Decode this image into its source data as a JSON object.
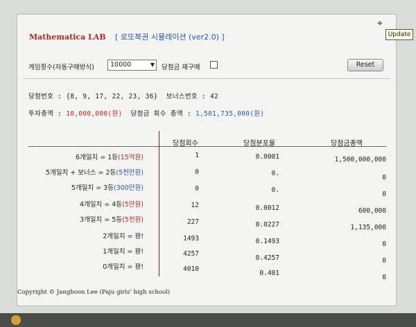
{
  "header": {
    "app_name": "Mathematica LAB",
    "sim_title": "[ 로또복권 시뮬레이션 (ver2.0) ]"
  },
  "controls": {
    "purchase_label": "게임횟수(자동구매방식)",
    "purchase_value": "10000",
    "repurchase_label": "당첨금 재구매",
    "repurchase_checked": false,
    "reset_label": "Reset"
  },
  "info": {
    "winning_label": "당첨번호 :",
    "winning_numbers": "{8, 9, 17, 22, 23, 36}",
    "bonus_label": "보너스번호 :",
    "bonus_number": "42",
    "investment_label": "투자총액 :",
    "investment_value": "10,000,000(원)",
    "prize_total_label": "당첨금 회수 총액 :",
    "prize_total_value": "1,501,735,000(원)"
  },
  "table": {
    "headers": [
      "당첨회수",
      "당첨분포율",
      "당첨금총액"
    ],
    "rows": [
      {
        "label": "6개일치 = 1등",
        "prize": "(15억원)",
        "count": "1",
        "rate": "0.0001",
        "amount": "1,500,000,000"
      },
      {
        "label": "5개일치 + 보너스 = 2등",
        "prize": "(5천만원)",
        "count": "0",
        "rate": "0.",
        "amount": "0"
      },
      {
        "label": "5개일치 = 3등",
        "prize": "(300만원)",
        "count": "0",
        "rate": "0.",
        "amount": "0"
      },
      {
        "label": "4개일치 = 4등",
        "prize": "(5만원)",
        "count": "12",
        "rate": "0.0012",
        "amount": "600,000"
      },
      {
        "label": "3개일치 = 5등",
        "prize": "(5천원)",
        "count": "227",
        "rate": "0.0227",
        "amount": "1,135,000"
      },
      {
        "label": "2개일치 = 꽝!",
        "prize": "",
        "count": "1493",
        "rate": "0.1493",
        "amount": "0"
      },
      {
        "label": "1개일치 = 꽝!",
        "prize": "",
        "count": "4257",
        "rate": "0.4257",
        "amount": "0"
      },
      {
        "label": "0개일치 = 꽝!",
        "prize": "",
        "count": "4010",
        "rate": "0.401",
        "amount": "0"
      }
    ]
  },
  "footer": {
    "copyright": "Copyright © Janghoon Lee (Paju girls' high school)"
  },
  "tooltip": {
    "update": "Update"
  },
  "icons": {
    "pointer": "mouse-pointer-icon",
    "taskbar": "taskbar-app-icon"
  }
}
